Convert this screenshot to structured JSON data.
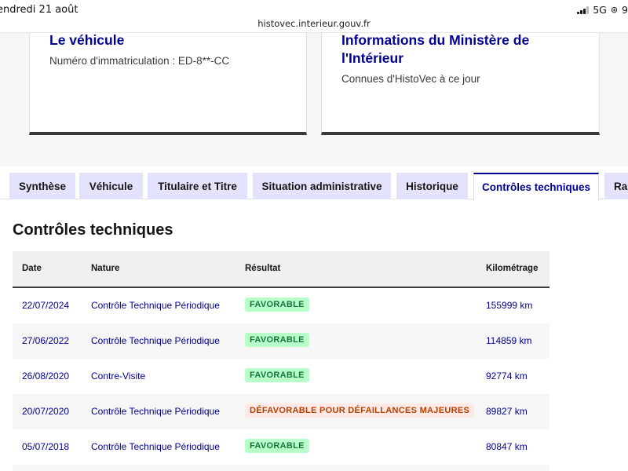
{
  "status_bar": {
    "date": "endredi 21 août",
    "url": "histovec.interieur.gouv.fr",
    "network": "5G",
    "battery": "9"
  },
  "cards": {
    "vehicle": {
      "title": "Le véhicule",
      "subtitle": "Numéro d'immatriculation : ED-8**-CC"
    },
    "ministry": {
      "title": "Informations du Ministère de l'Intérieur",
      "subtitle": "Connues d'HistoVec à ce jour"
    }
  },
  "tabs": [
    {
      "label": "Synthèse",
      "active": false
    },
    {
      "label": "Véhicule",
      "active": false
    },
    {
      "label": "Titulaire et Titre",
      "active": false
    },
    {
      "label": "Situation administrative",
      "active": false
    },
    {
      "label": "Historique",
      "active": false
    },
    {
      "label": "Contrôles techniques",
      "active": true
    },
    {
      "label": "Rap",
      "active": false
    }
  ],
  "section": {
    "title": "Contrôles techniques"
  },
  "table": {
    "headers": [
      "Date",
      "Nature",
      "Résultat",
      "Kilométrage"
    ],
    "rows": [
      {
        "date": "22/07/2024",
        "nature": "Contrôle Technique Périodique",
        "result": "FAVORABLE",
        "result_type": "ok",
        "km": "155999 km"
      },
      {
        "date": "27/06/2022",
        "nature": "Contrôle Technique Périodique",
        "result": "FAVORABLE",
        "result_type": "ok",
        "km": "114859 km"
      },
      {
        "date": "26/08/2020",
        "nature": "Contre-Visite",
        "result": "FAVORABLE",
        "result_type": "ok",
        "km": "92774 km"
      },
      {
        "date": "20/07/2020",
        "nature": "Contrôle Technique Périodique",
        "result": "DÉFAVORABLE POUR DÉFAILLANCES MAJEURES",
        "result_type": "ko",
        "km": "89827 km"
      },
      {
        "date": "05/07/2018",
        "nature": "Contrôle Technique Périodique",
        "result": "FAVORABLE",
        "result_type": "ok",
        "km": "80847 km"
      }
    ]
  },
  "colors": {
    "brand_blue": "#000091",
    "tab_bg": "#e3e3fd",
    "favorable_bg": "#b8fec9",
    "favorable_text": "#18753c",
    "defavorable_bg": "#ffe9e6",
    "defavorable_text": "#b34000"
  }
}
